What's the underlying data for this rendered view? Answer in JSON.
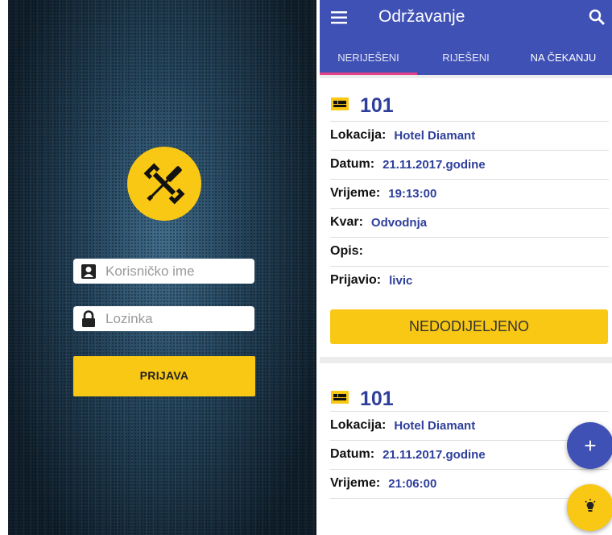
{
  "login": {
    "username_placeholder": "Korisničko ime",
    "password_placeholder": "Lozinka",
    "login_label": "PRIJAVA",
    "accent": "#f9c814"
  },
  "app": {
    "title": "Održavanje",
    "primary_color": "#3f51b5",
    "tabs": [
      {
        "label": "NERIJEŠENI",
        "active": true
      },
      {
        "label": "RIJEŠENI",
        "active": false
      },
      {
        "label": "NA ČEKANJU",
        "active": false
      }
    ],
    "cards": [
      {
        "room": "101",
        "rows": [
          {
            "key": "Lokacija:",
            "value": "Hotel Diamant"
          },
          {
            "key": "Datum:",
            "value": "21.11.2017.godine"
          },
          {
            "key": "Vrijeme:",
            "value": "19:13:00"
          },
          {
            "key": "Kvar:",
            "value": "Odvodnja"
          },
          {
            "key": "Opis:",
            "value": ""
          },
          {
            "key": "Prijavio:",
            "value": "livic"
          }
        ],
        "status": "NEDODIJELJENO"
      },
      {
        "room": "101",
        "rows": [
          {
            "key": "Lokacija:",
            "value": "Hotel Diamant"
          },
          {
            "key": "Datum:",
            "value": "21.11.2017.godine"
          },
          {
            "key": "Vrijeme:",
            "value": "21:06:00"
          }
        ]
      }
    ],
    "fab_add_label": "+",
    "icons": [
      "menu-icon",
      "search-icon",
      "bed-icon",
      "plus-icon",
      "lightbulb-icon",
      "person-icon",
      "lock-icon",
      "tools-icon"
    ]
  }
}
